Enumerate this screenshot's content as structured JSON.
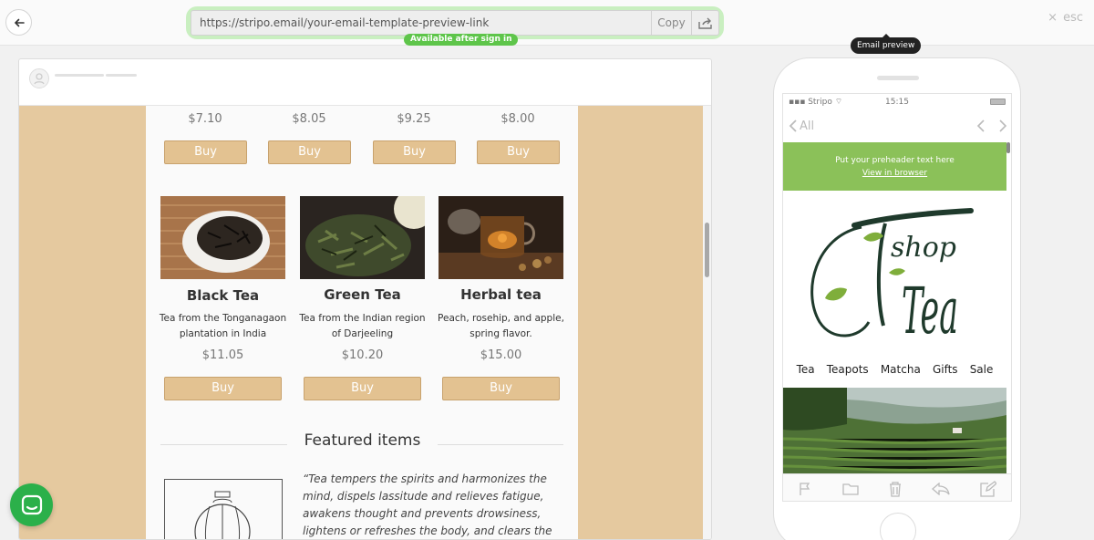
{
  "topbar": {
    "url": "https://stripo.email/your-email-template-preview-link",
    "copy_label": "Copy",
    "availability": "Available after sign in",
    "esc_label": "esc",
    "tooltip": "Email preview"
  },
  "products_top": [
    {
      "price": "$7.10",
      "buy": "Buy"
    },
    {
      "price": "$8.05",
      "buy": "Buy"
    },
    {
      "price": "$9.25",
      "buy": "Buy"
    },
    {
      "price": "$8.00",
      "buy": "Buy"
    }
  ],
  "products": [
    {
      "name": "Black Tea",
      "desc1": "Tea from the Tonganagaon",
      "desc2": "plantation in India",
      "price": "$11.05",
      "buy": "Buy"
    },
    {
      "name": "Green Tea",
      "desc1": "Tea from the Indian region",
      "desc2": "of Darjeeling",
      "price": "$10.20",
      "buy": "Buy"
    },
    {
      "name": "Herbal tea",
      "desc1": "Peach, rosehip, and apple,",
      "desc2": "spring flavor.",
      "price": "$15.00",
      "buy": "Buy"
    }
  ],
  "featured": {
    "title": "Featured items",
    "quote_lines": [
      "“Tea tempers the spirits and harmonizes the",
      "mind, dispels lassitude and relieves fatigue,",
      "awakens thought and prevents drowsiness,",
      "lightens or refreshes the body, and clears the"
    ]
  },
  "phone": {
    "carrier": "Stripo",
    "time": "15:15",
    "back_label": "All",
    "preheader": "Put your preheader text here",
    "view_in_browser": "View in browser",
    "logo_word_small": "shop",
    "logo_word_large": "Tea",
    "menu": [
      "Tea",
      "Teapots",
      "Matcha",
      "Gifts",
      "Sale"
    ]
  },
  "colors": {
    "accent_green": "#8bc159",
    "badge_green": "#5ec54a",
    "email_bg": "#e5c99f",
    "button_tan": "#e3c291",
    "logo_dark": "#1f3a2c",
    "chat_green": "#2bb04a"
  }
}
